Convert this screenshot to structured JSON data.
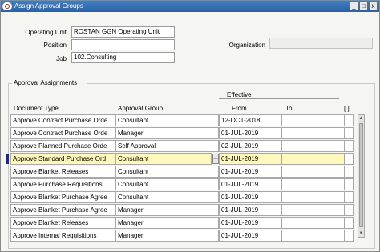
{
  "window": {
    "title": "Assign Approval Groups",
    "controls": [
      "_",
      "□",
      "x"
    ]
  },
  "form": {
    "operating_unit_label": "Operating Unit",
    "operating_unit_value": "ROSTAN GGN Operating Unit",
    "position_label": "Position",
    "position_value": "",
    "job_label": "Job",
    "job_value": "102.Consulting",
    "organization_label": "Organization",
    "organization_value": ""
  },
  "assignments": {
    "section_title": "Approval Assignments",
    "effective_label": "Effective",
    "columns": [
      "Document Type",
      "Approval Group",
      "From",
      "To",
      "[ ]"
    ],
    "rows": [
      {
        "document_type": "Approve Contract Purchase Orde",
        "approval_group": "Consultant",
        "from": "12-OCT-2018",
        "to": ""
      },
      {
        "document_type": "Approve Contract Purchase Orde",
        "approval_group": "Manager",
        "from": "01-JUL-2019",
        "to": ""
      },
      {
        "document_type": "Approve Planned Purchase Orde",
        "approval_group": "Self Approval",
        "from": "02-JUL-2019",
        "to": ""
      },
      {
        "document_type": "Approve Standard Purchase Ord",
        "approval_group": "Consultant",
        "from": "01-JUL-2019",
        "to": "",
        "active": true
      },
      {
        "document_type": "Approve Blanket Releases",
        "approval_group": "Consultant",
        "from": "01-JUL-2019",
        "to": ""
      },
      {
        "document_type": "Approve Purchase Requisitions",
        "approval_group": "Consultant",
        "from": "01-JUL-2019",
        "to": ""
      },
      {
        "document_type": "Approve Blanket Purchase Agree",
        "approval_group": "Consultant",
        "from": "01-JUL-2019",
        "to": ""
      },
      {
        "document_type": "Approve Blanket Purchase Agree",
        "approval_group": "Manager",
        "from": "01-JUL-2019",
        "to": ""
      },
      {
        "document_type": "Approve Blanket Releases",
        "approval_group": "Manager",
        "from": "01-JUL-2019",
        "to": ""
      },
      {
        "document_type": "Approve Internal Requisitions",
        "approval_group": "Manager",
        "from": "01-JUL-2019",
        "to": ""
      }
    ],
    "lov_glyph": "..."
  },
  "colors": {
    "titlebar": "#2b61a6",
    "active_row": "#fff8bc",
    "selection_marker": "#1a2a8a"
  }
}
